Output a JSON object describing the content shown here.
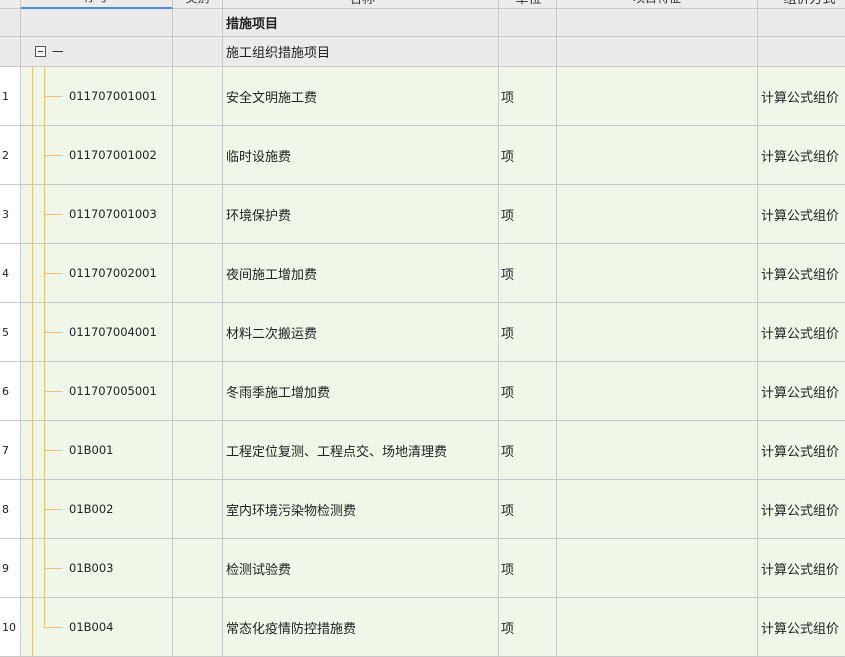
{
  "header": {
    "code": "序号",
    "category": "类别",
    "name": "名称",
    "unit": "单位",
    "feature": "项目特征",
    "calc": "组价方式"
  },
  "group1": {
    "name": "措施项目"
  },
  "group2": {
    "code": "一",
    "name": "施工组织措施项目"
  },
  "rows": [
    {
      "idx": "1",
      "code": "011707001001",
      "name": "安全文明施工费",
      "unit": "项",
      "calc": "计算公式组价"
    },
    {
      "idx": "2",
      "code": "011707001002",
      "name": "临时设施费",
      "unit": "项",
      "calc": "计算公式组价"
    },
    {
      "idx": "3",
      "code": "011707001003",
      "name": "环境保护费",
      "unit": "项",
      "calc": "计算公式组价"
    },
    {
      "idx": "4",
      "code": "011707002001",
      "name": "夜间施工增加费",
      "unit": "项",
      "calc": "计算公式组价"
    },
    {
      "idx": "5",
      "code": "011707004001",
      "name": "材料二次搬运费",
      "unit": "项",
      "calc": "计算公式组价"
    },
    {
      "idx": "6",
      "code": "011707005001",
      "name": "冬雨季施工增加费",
      "unit": "项",
      "calc": "计算公式组价"
    },
    {
      "idx": "7",
      "code": "01B001",
      "name": "工程定位复测、工程点交、场地清理费",
      "unit": "项",
      "calc": "计算公式组价"
    },
    {
      "idx": "8",
      "code": "01B002",
      "name": "室内环境污染物检测费",
      "unit": "项",
      "calc": "计算公式组价"
    },
    {
      "idx": "9",
      "code": "01B003",
      "name": "检测试验费",
      "unit": "项",
      "calc": "计算公式组价"
    },
    {
      "idx": "10",
      "code": "01B004",
      "name": "常态化疫情防控措施费",
      "unit": "项",
      "calc": "计算公式组价"
    }
  ]
}
